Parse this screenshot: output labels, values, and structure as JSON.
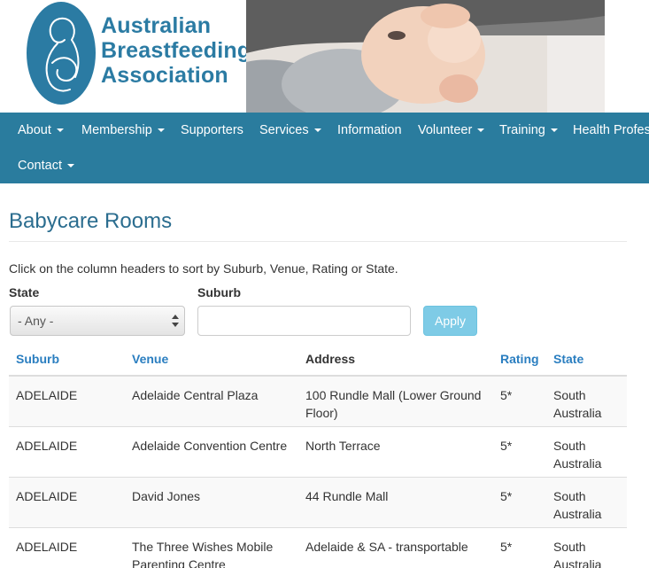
{
  "logo": {
    "line1": "Australian",
    "line2": "Breastfeeding",
    "line3": "Association"
  },
  "nav": {
    "items": [
      {
        "label": "About",
        "dropdown": true
      },
      {
        "label": "Membership",
        "dropdown": true
      },
      {
        "label": "Supporters",
        "dropdown": false
      },
      {
        "label": "Services",
        "dropdown": true
      },
      {
        "label": "Information",
        "dropdown": false
      },
      {
        "label": "Volunteer",
        "dropdown": true
      },
      {
        "label": "Training",
        "dropdown": true
      },
      {
        "label": "Health Profes",
        "dropdown": false
      },
      {
        "label": "Contact",
        "dropdown": true
      }
    ]
  },
  "page": {
    "title": "Babycare Rooms",
    "intro": "Click on the column headers to sort by Suburb, Venue, Rating or State."
  },
  "filters": {
    "state_label": "State",
    "state_value": "- Any -",
    "suburb_label": "Suburb",
    "suburb_value": "",
    "apply_label": "Apply"
  },
  "table": {
    "headers": {
      "suburb": "Suburb",
      "venue": "Venue",
      "address": "Address",
      "rating": "Rating",
      "state": "State"
    },
    "rows": [
      {
        "suburb": "ADELAIDE",
        "venue": "Adelaide Central Plaza",
        "address_1": "100 Rundle Mall (Lower Ground",
        "address_2": "Floor)",
        "venue_2": "",
        "rating": "5*",
        "state_1": "South",
        "state_2": "Australia"
      },
      {
        "suburb": "ADELAIDE",
        "venue": "Adelaide Convention Centre",
        "address_1": "North Terrace",
        "address_2": "",
        "venue_2": "",
        "rating": "5*",
        "state_1": "South",
        "state_2": "Australia"
      },
      {
        "suburb": "ADELAIDE",
        "venue": "David Jones",
        "address_1": "44 Rundle Mall",
        "address_2": "",
        "venue_2": "",
        "rating": "5*",
        "state_1": "South",
        "state_2": "Australia"
      },
      {
        "suburb": "ADELAIDE",
        "venue": "The Three Wishes Mobile",
        "venue_2": "Parenting Centre",
        "address_1": "Adelaide & SA - transportable",
        "address_2": "",
        "rating": "5*",
        "state_1": "South",
        "state_2": "Australia"
      }
    ]
  },
  "colors": {
    "brand": "#2b7ba3",
    "nav_bg": "#2a7c9e",
    "link": "#2a7ec0",
    "apply_bg": "#7ecbe6"
  }
}
